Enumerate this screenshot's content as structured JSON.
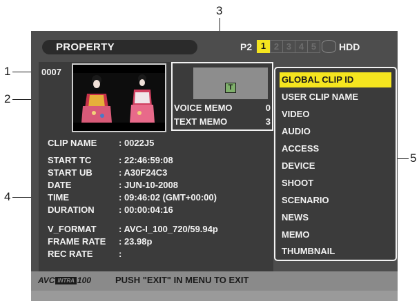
{
  "callouts": [
    "1",
    "2",
    "3",
    "4",
    "5"
  ],
  "header": {
    "title": "PROPERTY",
    "p2_label": "P2",
    "slots": [
      {
        "label": "1",
        "state": "active"
      },
      {
        "label": "2",
        "state": "inactive"
      },
      {
        "label": "3",
        "state": "inactive"
      },
      {
        "label": "4",
        "state": "inactive"
      },
      {
        "label": "5",
        "state": "inactive"
      }
    ],
    "hdd_icon": "hdd-drive-icon",
    "hdd_label": "HDD"
  },
  "clip": {
    "number": "0007",
    "thumbnail_icon": "clip-thumbnail-image"
  },
  "memo": {
    "text_memo_icon_letter": "T",
    "voice_memo_label": "VOICE MEMO",
    "voice_memo_count": "0",
    "text_memo_label": "TEXT MEMO",
    "text_memo_count": "3"
  },
  "properties": [
    {
      "label": "CLIP NAME",
      "value": ": 0022J5"
    },
    {
      "label": "START TC",
      "value": ": 22:46:59:08"
    },
    {
      "label": "START UB",
      "value": ": A30F24C3"
    },
    {
      "label": "DATE",
      "value": ": JUN-10-2008"
    },
    {
      "label": "TIME",
      "value": ": 09:46:02 (GMT+00:00)"
    },
    {
      "label": "DURATION",
      "value": ": 00:00:04:16"
    },
    {
      "label": "V_FORMAT",
      "value": ": AVC-I_100_720/59.94p"
    },
    {
      "label": "FRAME RATE",
      "value": ": 23.98p"
    },
    {
      "label": "REC RATE",
      "value": ":"
    }
  ],
  "menu": {
    "items": [
      {
        "label": "GLOBAL CLIP ID",
        "selected": true
      },
      {
        "label": "USER CLIP NAME",
        "selected": false
      },
      {
        "label": "VIDEO",
        "selected": false
      },
      {
        "label": "AUDIO",
        "selected": false
      },
      {
        "label": "ACCESS",
        "selected": false
      },
      {
        "label": "DEVICE",
        "selected": false
      },
      {
        "label": "SHOOT",
        "selected": false
      },
      {
        "label": "SCENARIO",
        "selected": false
      },
      {
        "label": "NEWS",
        "selected": false
      },
      {
        "label": "MEMO",
        "selected": false
      },
      {
        "label": "THUMBNAIL",
        "selected": false
      }
    ]
  },
  "footer": {
    "logo_avc": "AVC",
    "logo_intra": "INTRA",
    "logo_num": "100",
    "message": "PUSH \"EXIT\" IN MENU TO EXIT"
  },
  "colors": {
    "highlight": "#f5e51f",
    "panel": "#3b3b3b",
    "screen": "#4d4d4d",
    "footer": "#8a8a8a"
  }
}
